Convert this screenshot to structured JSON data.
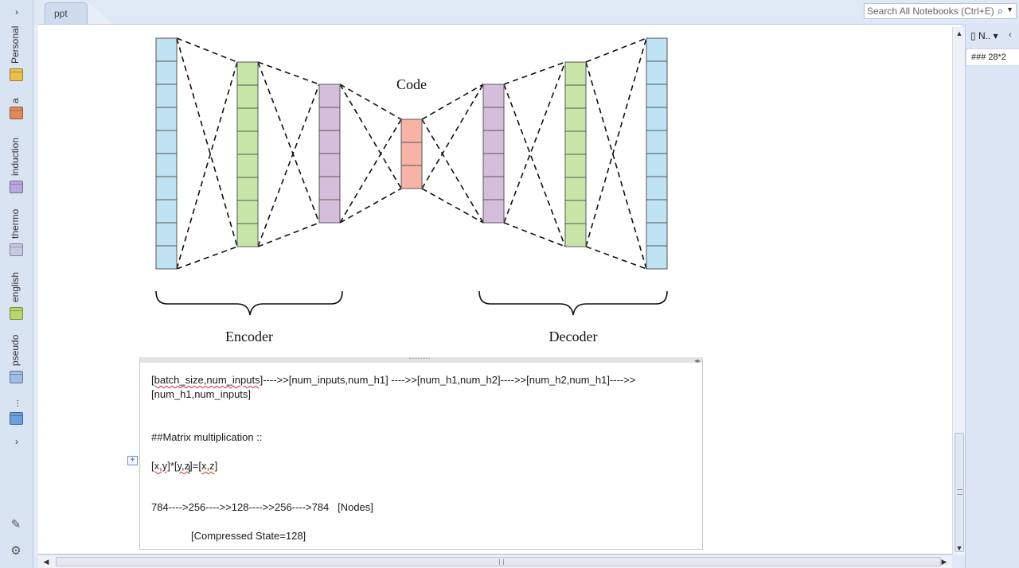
{
  "tabs": {
    "active": "ppt"
  },
  "search": {
    "placeholder": "Search All Notebooks (Ctrl+E)"
  },
  "notebooks": [
    {
      "label": "Personal",
      "color": "#e9c04a"
    },
    {
      "label": "a",
      "color": "#e08a5c"
    },
    {
      "label": "induction",
      "color": "#b9a6dc"
    },
    {
      "label": "thermo",
      "color": "#c8c8e6"
    },
    {
      "label": "english",
      "color": "#b9d66a"
    },
    {
      "label": "pseudo",
      "color": "#9fbbe6"
    },
    {
      "label": "...",
      "color": "#6aa0dc"
    }
  ],
  "page_pane": {
    "new_page_label": "N..",
    "pages": [
      "### 28*2"
    ]
  },
  "figure": {
    "code_label": "Code",
    "encoder_label": "Encoder",
    "decoder_label": "Decoder"
  },
  "note": {
    "line1_a": "[batch_size,num_inputs]",
    "line1_b": "---->>[num_inputs,num_h1] ---->>[num_h1,num_h2]---->>[num_h2,num_h1]---->>",
    "line2": "[num_h1,num_inputs]",
    "line3": "##Matrix multiplication ::",
    "line4_a": "[x,y]",
    "line4_b": "*[",
    "line4_c": "y,z",
    "line4_d": "]=[",
    "line4_e": "x,z",
    "line4_f": "]",
    "line5": "784---->256---->>128---->>256---->784   [Nodes]",
    "line6": "[Compressed State=128]"
  }
}
